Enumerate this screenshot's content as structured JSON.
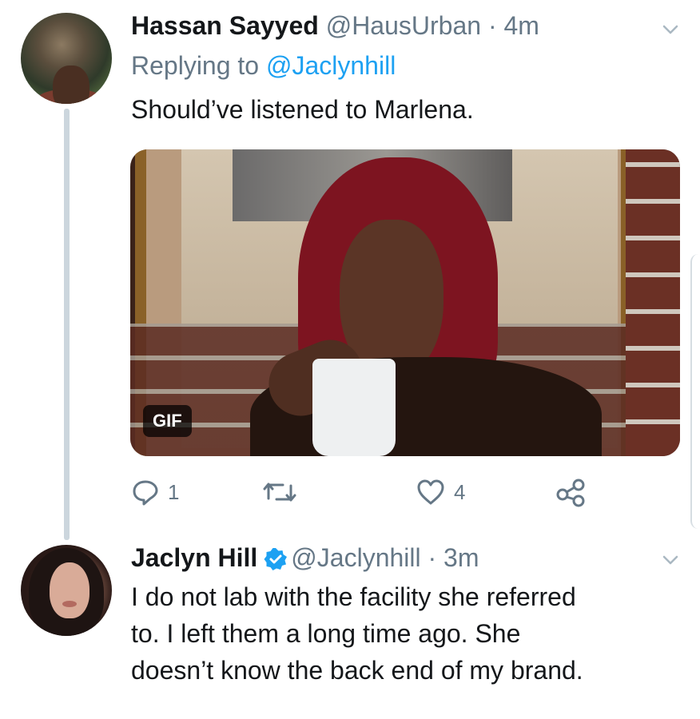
{
  "tweets": [
    {
      "name": "Hassan Sayyed",
      "handle": "@HausUrban",
      "separator": "·",
      "time": "4m",
      "reply_prefix": "Replying to",
      "reply_to": "@Jaclynhill",
      "text": "Should’ve listened to Marlena.",
      "media_badge": "GIF",
      "reply_count": "1",
      "like_count": "4"
    },
    {
      "name": "Jaclyn Hill",
      "handle": "@Jaclynhill",
      "separator": "·",
      "time": "3m",
      "text_lines": [
        "I do not lab with the facility she referred",
        "to. I left them a long time ago. She",
        "doesn’t know the back end of my brand."
      ]
    }
  ],
  "colors": {
    "text": "#14171a",
    "secondary": "#657786",
    "link": "#1da1f2",
    "thread_line": "#ccd6dd"
  },
  "icons": [
    "reply-icon",
    "retweet-icon",
    "like-icon",
    "share-icon",
    "chevron-down-icon",
    "verified-badge-icon"
  ]
}
